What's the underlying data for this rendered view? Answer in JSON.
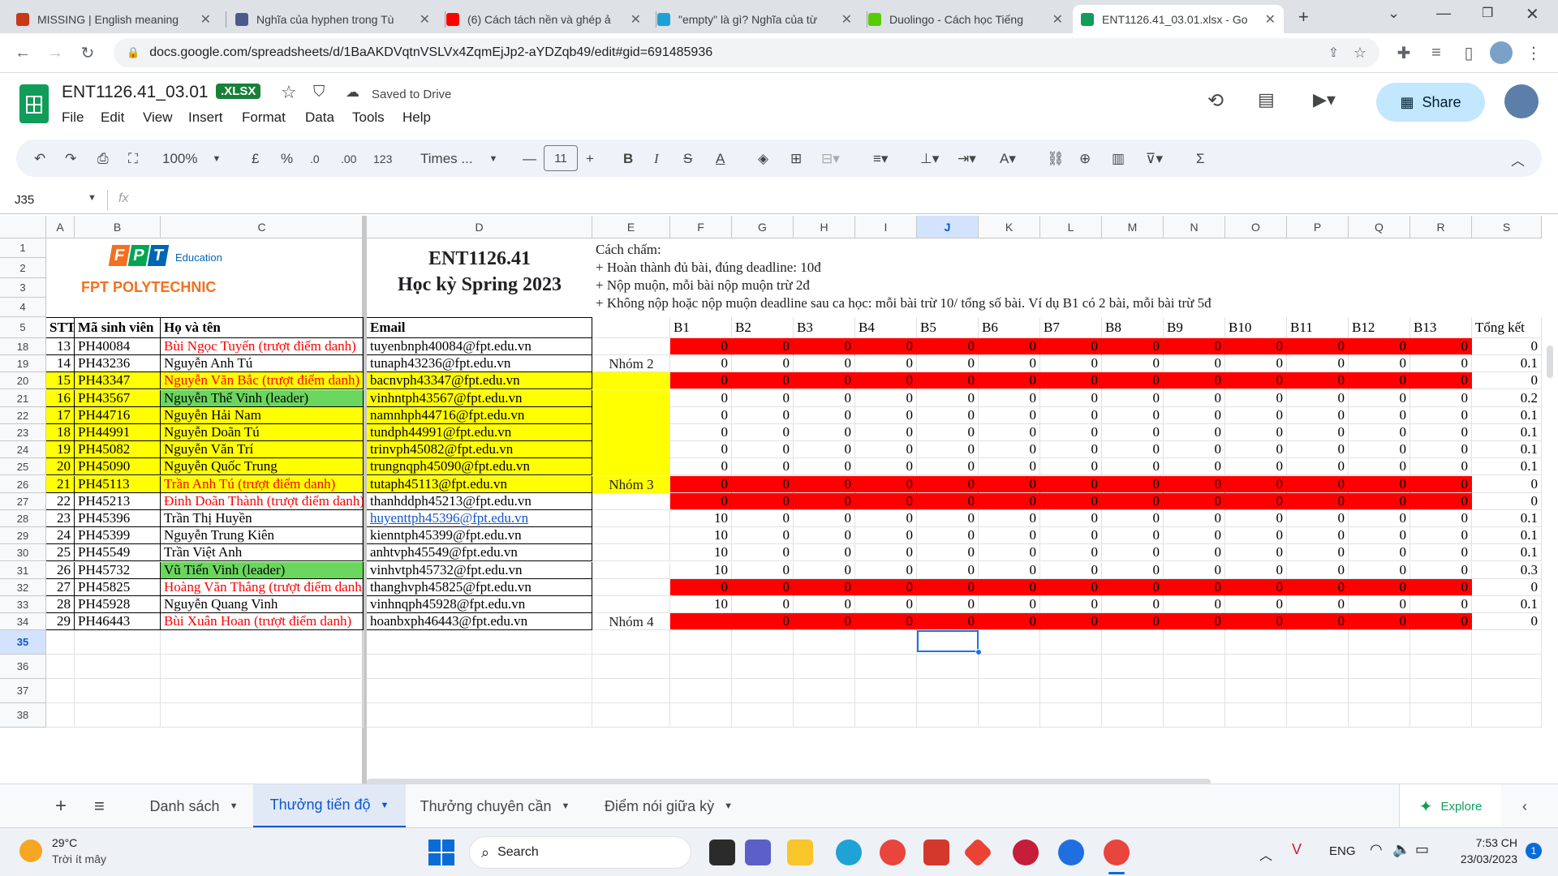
{
  "browser": {
    "tabs": [
      {
        "title": "MISSING | English meaning",
        "color": "#c8391a"
      },
      {
        "title": "Nghĩa của hyphen trong Tù",
        "color": "#4a5a8a"
      },
      {
        "title": "(6) Cách tách nền và ghép ả",
        "color": "#ff0000"
      },
      {
        "title": "\"empty\" là gì? Nghĩa của từ",
        "color": "#1ca1d6"
      },
      {
        "title": "Duolingo - Cách học Tiếng",
        "color": "#58cc02"
      },
      {
        "title": "ENT1126.41_03.01.xlsx - Go",
        "color": "#0f9d58"
      }
    ],
    "url": "docs.google.com/spreadsheets/d/1BaAKDVqtnVSLVx4ZqmEjJp2-aYDZqb49/edit#gid=691485936"
  },
  "sheets": {
    "doc_title": "ENT1126.41_03.01",
    "badge": ".XLSX",
    "saved": "Saved to Drive",
    "share": "Share",
    "menu": [
      "File",
      "Edit",
      "View",
      "Insert",
      "Format",
      "Data",
      "Tools",
      "Help"
    ],
    "toolbar": {
      "zoom": "100%",
      "currency": "£",
      "percent": "%",
      "dec_minus": ".0",
      "dec_plus": ".00",
      "format123": "123",
      "font": "Times ...",
      "font_size": "11"
    },
    "namebox": "J35",
    "fx": "fx"
  },
  "grid": {
    "columns": [
      "A",
      "B",
      "C",
      "D",
      "E",
      "F",
      "G",
      "H",
      "I",
      "J",
      "K",
      "L",
      "M",
      "N",
      "O",
      "P",
      "Q",
      "R",
      "S"
    ],
    "header_rows": [
      "1",
      "2",
      "3",
      "4",
      "5"
    ],
    "logo_main": "FPT",
    "logo_sub": "Education",
    "logo_poly": "FPT POLYTECHNIC",
    "course_title": "ENT1126.41",
    "semester": "Học kỳ Spring 2023",
    "grading_lines": [
      "Cách chấm:",
      "+ Hoàn thành đủ bài, đúng deadline: 10đ",
      "+ Nộp muộn, mỗi bài nộp muộn trừ 2đ",
      "+ Không nộp hoặc nộp muộn deadline sau ca học: mỗi bài trừ 10/ tổng số bài. Ví dụ B1 có 2 bài, mỗi bài trừ 5đ"
    ],
    "table_headers": [
      "STT",
      "Mã sinh viên",
      "Họ và tên",
      "Email",
      "",
      "B1",
      "B2",
      "B3",
      "B4",
      "B5",
      "B6",
      "B7",
      "B8",
      "B9",
      "B10",
      "B11",
      "B12",
      "B13",
      "Tổng kết"
    ],
    "group_labels": {
      "g2": "Nhóm 2",
      "g3": "Nhóm 3",
      "g4": "Nhóm 4"
    },
    "rows": [
      {
        "rn": "18",
        "stt": "13",
        "id": "PH40084",
        "name": "Bùi Ngọc Tuyến (trượt điểm danh)",
        "email": "tuyenbnph40084@fpt.edu.vn",
        "b": [
          "0",
          "0",
          "0",
          "0",
          "0",
          "0",
          "0",
          "0",
          "0",
          "0",
          "0",
          "0",
          "0"
        ],
        "total": "0"
      },
      {
        "rn": "19",
        "stt": "14",
        "id": "PH43236",
        "name": "Nguyễn Anh Tú",
        "email": "tunaph43236@fpt.edu.vn",
        "b": [
          "0",
          "0",
          "0",
          "0",
          "0",
          "0",
          "0",
          "0",
          "0",
          "0",
          "0",
          "0",
          "0"
        ],
        "total": "0.1"
      },
      {
        "rn": "20",
        "stt": "15",
        "id": "PH43347",
        "name": "Nguyễn Văn Bắc (trượt điểm danh)",
        "email": "bacnvph43347@fpt.edu.vn",
        "b": [
          "0",
          "0",
          "0",
          "0",
          "0",
          "0",
          "0",
          "0",
          "0",
          "0",
          "0",
          "0",
          "0"
        ],
        "total": "0"
      },
      {
        "rn": "21",
        "stt": "16",
        "id": "PH43567",
        "name": "Nguyễn Thế Vinh (leader)",
        "email": "vinhntph43567@fpt.edu.vn",
        "b": [
          "0",
          "0",
          "0",
          "0",
          "0",
          "0",
          "0",
          "0",
          "0",
          "0",
          "0",
          "0",
          "0"
        ],
        "total": "0.2"
      },
      {
        "rn": "22",
        "stt": "17",
        "id": "PH44716",
        "name": "Nguyễn Hải Nam",
        "email": "namnhph44716@fpt.edu.vn",
        "b": [
          "0",
          "0",
          "0",
          "0",
          "0",
          "0",
          "0",
          "0",
          "0",
          "0",
          "0",
          "0",
          "0"
        ],
        "total": "0.1"
      },
      {
        "rn": "23",
        "stt": "18",
        "id": "PH44991",
        "name": "Nguyễn Doãn Tú",
        "email": "tundph44991@fpt.edu.vn",
        "b": [
          "0",
          "0",
          "0",
          "0",
          "0",
          "0",
          "0",
          "0",
          "0",
          "0",
          "0",
          "0",
          "0"
        ],
        "total": "0.1"
      },
      {
        "rn": "24",
        "stt": "19",
        "id": "PH45082",
        "name": "Nguyễn Văn Trí",
        "email": "trinvph45082@fpt.edu.vn",
        "b": [
          "0",
          "0",
          "0",
          "0",
          "0",
          "0",
          "0",
          "0",
          "0",
          "0",
          "0",
          "0",
          "0"
        ],
        "total": "0.1"
      },
      {
        "rn": "25",
        "stt": "20",
        "id": "PH45090",
        "name": "Nguyễn Quốc Trung",
        "email": "trungnqph45090@fpt.edu.vn",
        "b": [
          "0",
          "0",
          "0",
          "0",
          "0",
          "0",
          "0",
          "0",
          "0",
          "0",
          "0",
          "0",
          "0"
        ],
        "total": "0.1"
      },
      {
        "rn": "26",
        "stt": "21",
        "id": "PH45113",
        "name": "Trần Anh Tú (trượt điểm danh)",
        "email": "tutaph45113@fpt.edu.vn",
        "b": [
          "0",
          "0",
          "0",
          "0",
          "0",
          "0",
          "0",
          "0",
          "0",
          "0",
          "0",
          "0",
          "0"
        ],
        "total": "0"
      },
      {
        "rn": "27",
        "stt": "22",
        "id": "PH45213",
        "name": "Đinh Doãn Thành (trượt điểm danh)",
        "email": "thanhddph45213@fpt.edu.vn",
        "b": [
          "0",
          "0",
          "0",
          "0",
          "0",
          "0",
          "0",
          "0",
          "0",
          "0",
          "0",
          "0",
          "0"
        ],
        "total": "0"
      },
      {
        "rn": "28",
        "stt": "23",
        "id": "PH45396",
        "name": "Trần Thị Huyền",
        "email": "huyenttph45396@fpt.edu.vn",
        "b": [
          "10",
          "0",
          "0",
          "0",
          "0",
          "0",
          "0",
          "0",
          "0",
          "0",
          "0",
          "0",
          "0"
        ],
        "total": "0.1"
      },
      {
        "rn": "29",
        "stt": "24",
        "id": "PH45399",
        "name": "Nguyễn Trung Kiên",
        "email": "kienntph45399@fpt.edu.vn",
        "b": [
          "10",
          "0",
          "0",
          "0",
          "0",
          "0",
          "0",
          "0",
          "0",
          "0",
          "0",
          "0",
          "0"
        ],
        "total": "0.1"
      },
      {
        "rn": "30",
        "stt": "25",
        "id": "PH45549",
        "name": "Trần Việt Anh",
        "email": "anhtvph45549@fpt.edu.vn",
        "b": [
          "10",
          "0",
          "0",
          "0",
          "0",
          "0",
          "0",
          "0",
          "0",
          "0",
          "0",
          "0",
          "0"
        ],
        "total": "0.1"
      },
      {
        "rn": "31",
        "stt": "26",
        "id": "PH45732",
        "name": "Vũ Tiến Vinh (leader)",
        "email": "vinhvtph45732@fpt.edu.vn",
        "b": [
          "10",
          "0",
          "0",
          "0",
          "0",
          "0",
          "0",
          "0",
          "0",
          "0",
          "0",
          "0",
          "0"
        ],
        "total": "0.3"
      },
      {
        "rn": "32",
        "stt": "27",
        "id": "PH45825",
        "name": "Hoàng Văn Thắng (trượt điểm danh)",
        "email": "thanghvph45825@fpt.edu.vn",
        "b": [
          "0",
          "0",
          "0",
          "0",
          "0",
          "0",
          "0",
          "0",
          "0",
          "0",
          "0",
          "0",
          "0"
        ],
        "total": "0"
      },
      {
        "rn": "33",
        "stt": "28",
        "id": "PH45928",
        "name": "Nguyễn Quang Vinh",
        "email": "vinhnqph45928@fpt.edu.vn",
        "b": [
          "10",
          "0",
          "0",
          "0",
          "0",
          "0",
          "0",
          "0",
          "0",
          "0",
          "0",
          "0",
          "0"
        ],
        "total": "0.1"
      },
      {
        "rn": "34",
        "stt": "29",
        "id": "PH46443",
        "name": "Bùi Xuân Hoan (trượt điểm danh)",
        "email": "hoanbxph46443@fpt.edu.vn",
        "b": [
          "",
          "0",
          "0",
          "0",
          "0",
          "0",
          "0",
          "0",
          "0",
          "0",
          "0",
          "0",
          "0"
        ],
        "total": "0"
      }
    ],
    "empty_rows": [
      "35",
      "36",
      "37",
      "38"
    ]
  },
  "sheet_tabs": {
    "add": "+",
    "tabs": [
      "Danh sách",
      "Thưởng tiến độ",
      "Thưởng chuyên cần",
      "Điểm nói giữa kỳ"
    ],
    "explore": "Explore"
  },
  "taskbar": {
    "weather_temp": "29°C",
    "weather_desc": "Trời ít mây",
    "search": "Search",
    "lang": "ENG",
    "time": "7:53 CH",
    "date": "23/03/2023",
    "notif": "1"
  },
  "colors": {
    "red": "#ff0000",
    "yellow": "#ffff00",
    "green": "#6bd65d",
    "accent": "#c2e7ff"
  }
}
